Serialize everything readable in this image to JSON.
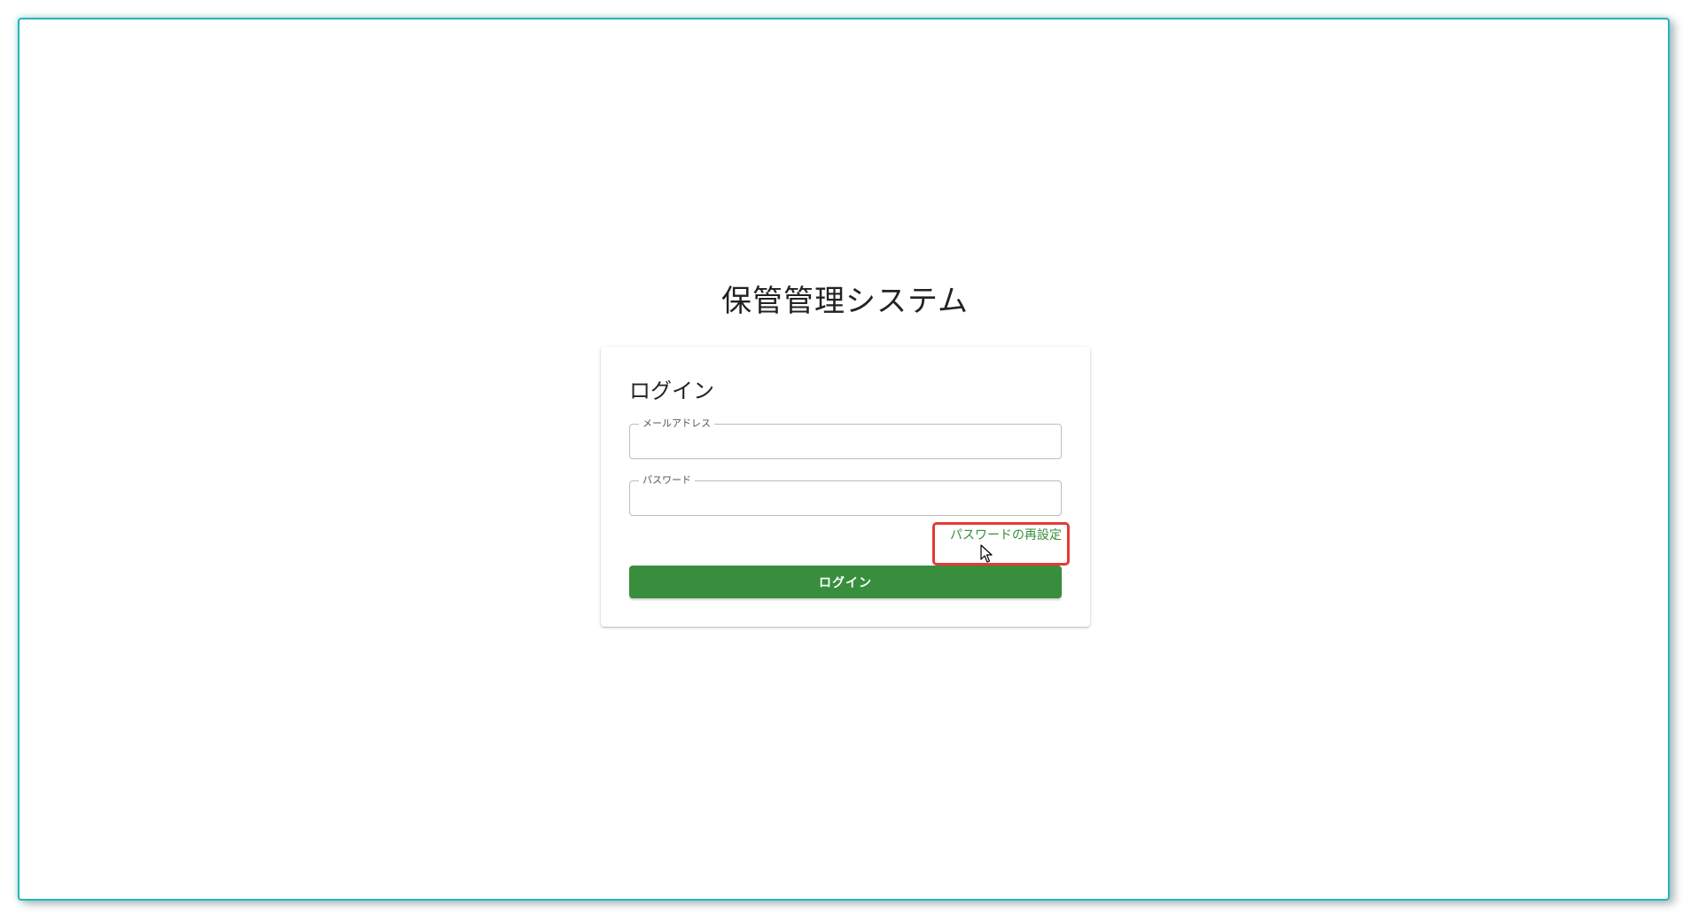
{
  "app": {
    "title": "保管管理システム"
  },
  "login_card": {
    "heading": "ログイン",
    "email_field": {
      "label": "メールアドレス",
      "value": "",
      "placeholder": ""
    },
    "password_field": {
      "label": "パスワード",
      "value": "",
      "placeholder": ""
    },
    "reset_password_link": "パスワードの再設定",
    "login_button": "ログイン"
  },
  "colors": {
    "primary_green": "#388e3c",
    "highlight_red": "#e53935",
    "frame_teal": "#2bb3b8"
  },
  "icons": {
    "cursor": "mouse-pointer-icon"
  }
}
